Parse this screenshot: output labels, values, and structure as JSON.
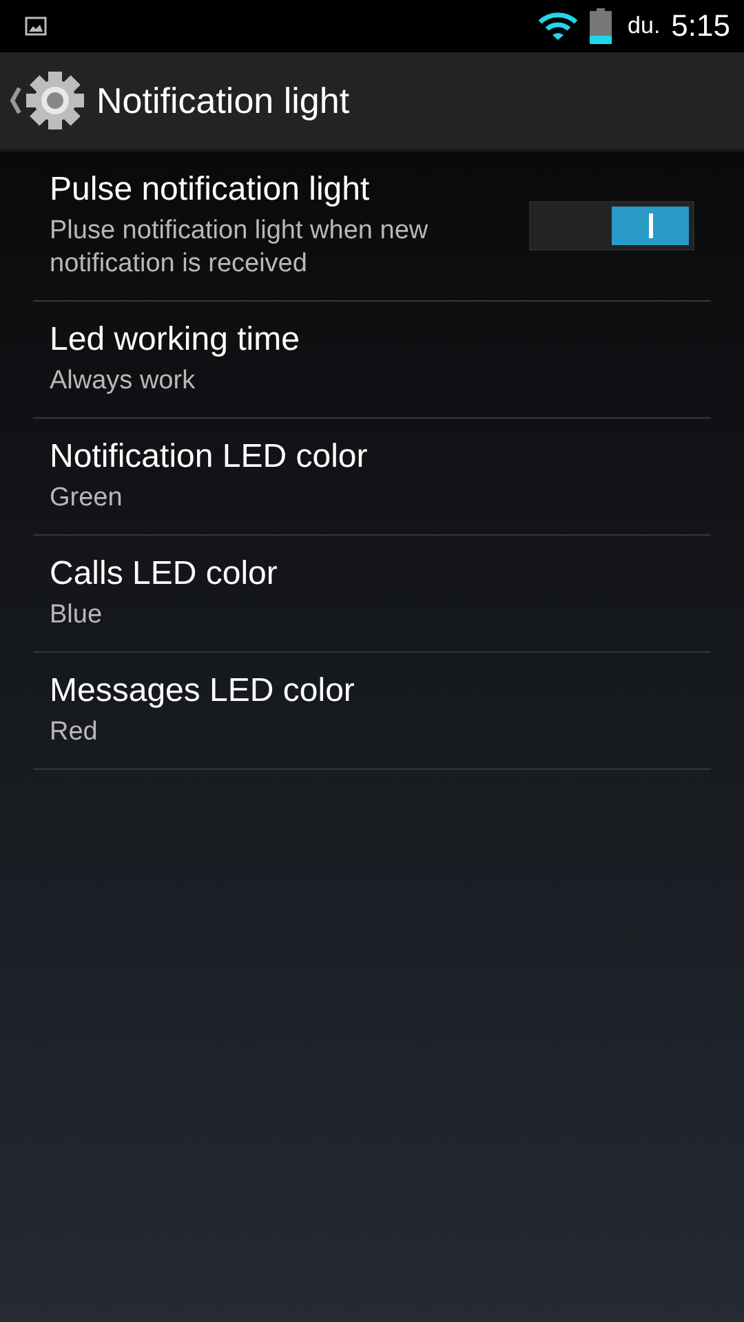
{
  "status_bar": {
    "day": "du.",
    "time": "5:15"
  },
  "action_bar": {
    "title": "Notification light"
  },
  "settings": [
    {
      "kind": "switch",
      "title": "Pulse notification light",
      "summary": "Pluse notification light when new notification is received",
      "on": true
    },
    {
      "kind": "value",
      "title": "Led working time",
      "summary": "Always work"
    },
    {
      "kind": "value",
      "title": "Notification LED color",
      "summary": "Green"
    },
    {
      "kind": "value",
      "title": "Calls LED color",
      "summary": "Blue"
    },
    {
      "kind": "value",
      "title": "Messages LED color",
      "summary": "Red"
    }
  ]
}
